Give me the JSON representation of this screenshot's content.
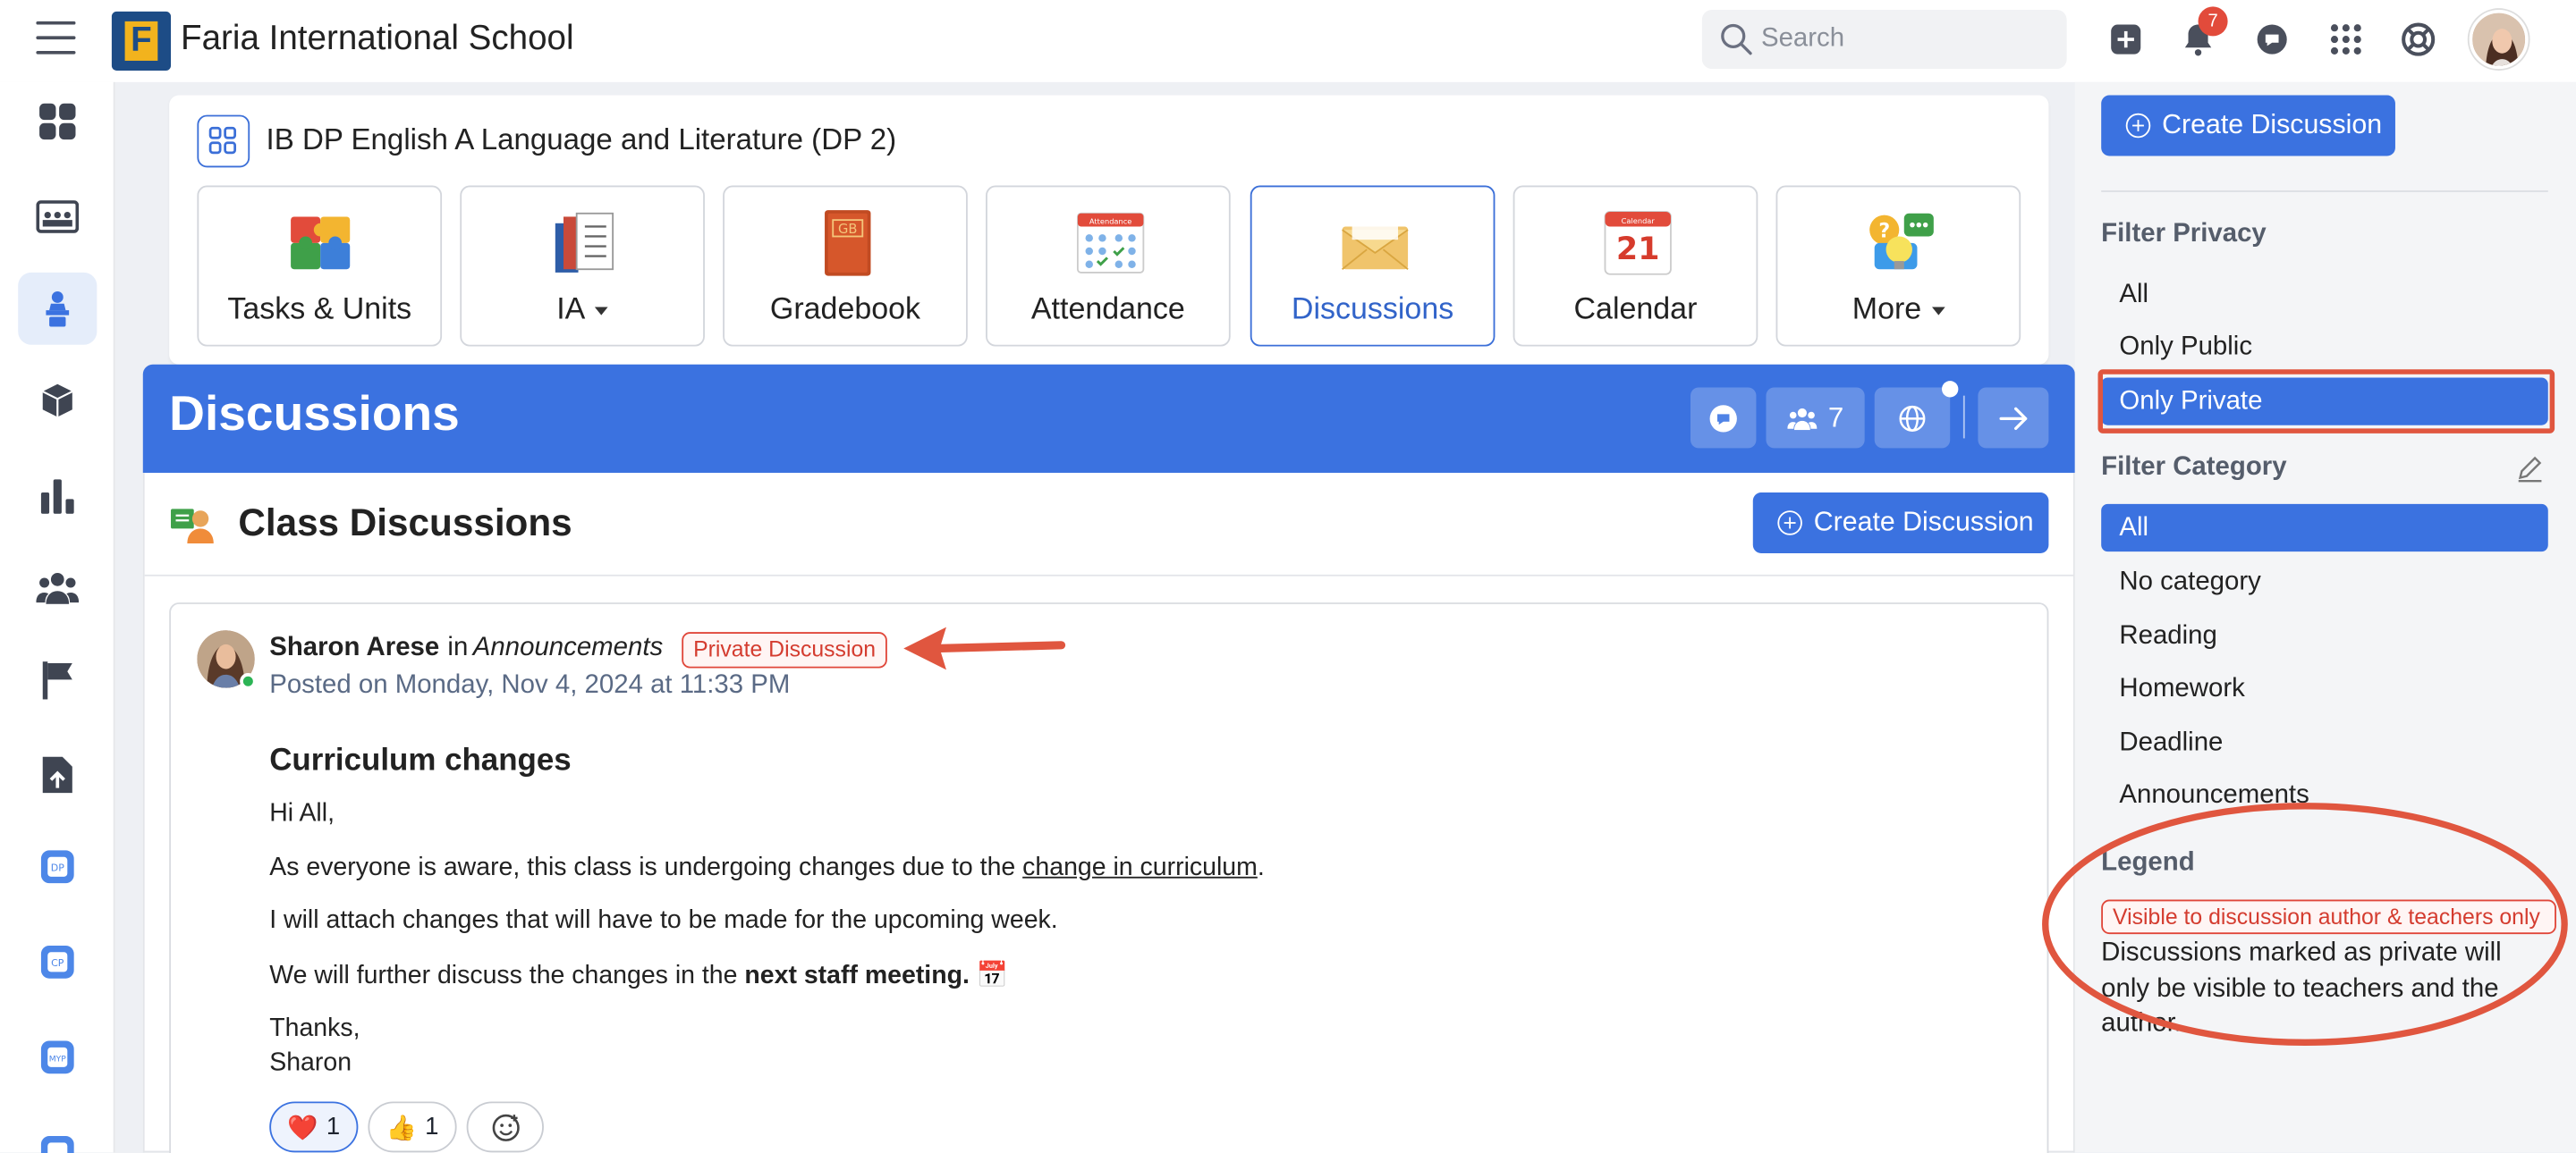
{
  "topbar": {
    "logo_letter": "F",
    "school_name": "Faria International School",
    "search_placeholder": "Search",
    "notification_count": "7"
  },
  "course": {
    "title": "IB DP English A Language and Literature (DP 2)",
    "tools": [
      {
        "label": "Tasks & Units"
      },
      {
        "label": "IA"
      },
      {
        "label": "Gradebook"
      },
      {
        "label": "Attendance"
      },
      {
        "label": "Discussions"
      },
      {
        "label": "Calendar"
      },
      {
        "label": "More"
      }
    ],
    "gradebook_icon_text": "GB",
    "calendar_icon_number": "21",
    "calendar_icon_caption": "Calendar",
    "attendance_icon_caption": "Attendance"
  },
  "discussions": {
    "header_title": "Discussions",
    "members_count": "7",
    "section_title": "Class Discussions",
    "create_label": "Create Discussion"
  },
  "post": {
    "author": "Sharon Arese",
    "in_word": "in",
    "category": "Announcements",
    "private_tag": "Private Discussion",
    "posted": "Posted on Monday, Nov 4, 2024 at 11:33 PM",
    "title": "Curriculum changes",
    "greeting": "Hi All,",
    "line1_a": "As everyone is aware, this class is undergoing changes due to the ",
    "line1_link": "change in curriculum",
    "line1_b": ".",
    "line2": "I will attach changes that will have to be made for the upcoming week.",
    "line3_a": "We will further discuss the changes in the ",
    "line3_bold": "next staff meeting.",
    "line3_emoji": "📅",
    "signoff": "Thanks,",
    "signature": "Sharon",
    "reactions": [
      {
        "emoji": "❤️",
        "count": "1"
      },
      {
        "emoji": "👍",
        "count": "1"
      }
    ]
  },
  "sidebar": {
    "create_label": "Create Discussion",
    "privacy_title": "Filter Privacy",
    "privacy_items": [
      "All",
      "Only Public",
      "Only Private"
    ],
    "category_title": "Filter Category",
    "category_items": [
      "All",
      "No category",
      "Reading",
      "Homework",
      "Deadline",
      "Announcements"
    ],
    "legend_title": "Legend",
    "legend_tag": "Visible to discussion author & teachers only",
    "legend_text": "Discussions marked as private will only be visible to teachers and the author."
  },
  "colors": {
    "accent": "#3b72e0",
    "private_red": "#d43c2f",
    "annotation": "#e0563f"
  }
}
